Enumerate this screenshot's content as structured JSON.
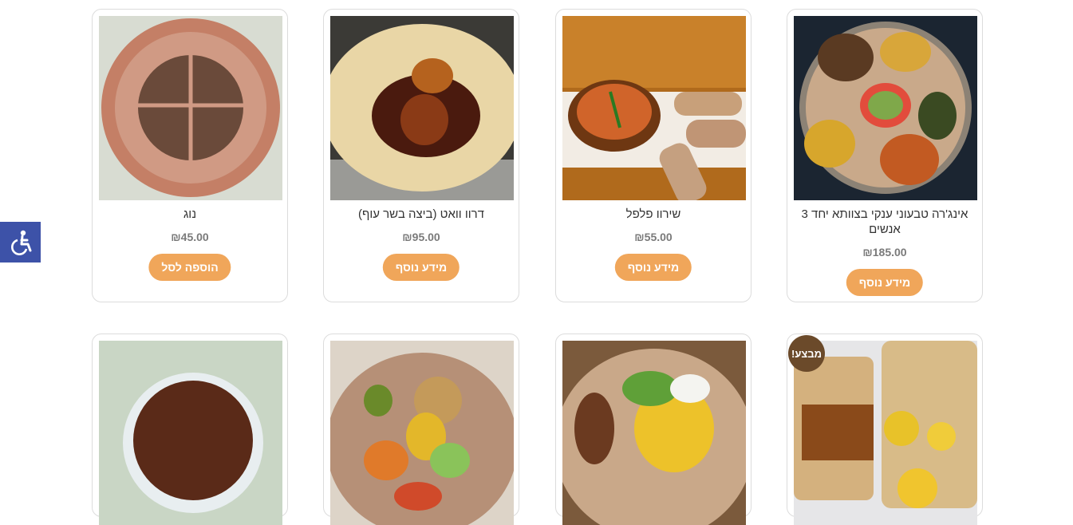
{
  "accessibility": {
    "icon": "accessibility-wheelchair-icon",
    "color": "#3d52a8"
  },
  "theme": {
    "accent": "#f0a65a",
    "badge": "#6b4a2a"
  },
  "products": [
    {
      "title": "אינג'רה טבעוני ענקי בצוותא יחד 3 אנשים",
      "price": "₪185.00",
      "button": "מידע נוסף"
    },
    {
      "title": "שירוו פלפל",
      "price": "₪55.00",
      "button": "מידע נוסף"
    },
    {
      "title": "דרוו וואט (ביצה בשר עוף)",
      "price": "₪95.00",
      "button": "מידע נוסף"
    },
    {
      "title": "נוג",
      "price": "₪45.00",
      "button": "הוספה לסל"
    }
  ],
  "row2": {
    "sale_badge": "מבצע!"
  }
}
